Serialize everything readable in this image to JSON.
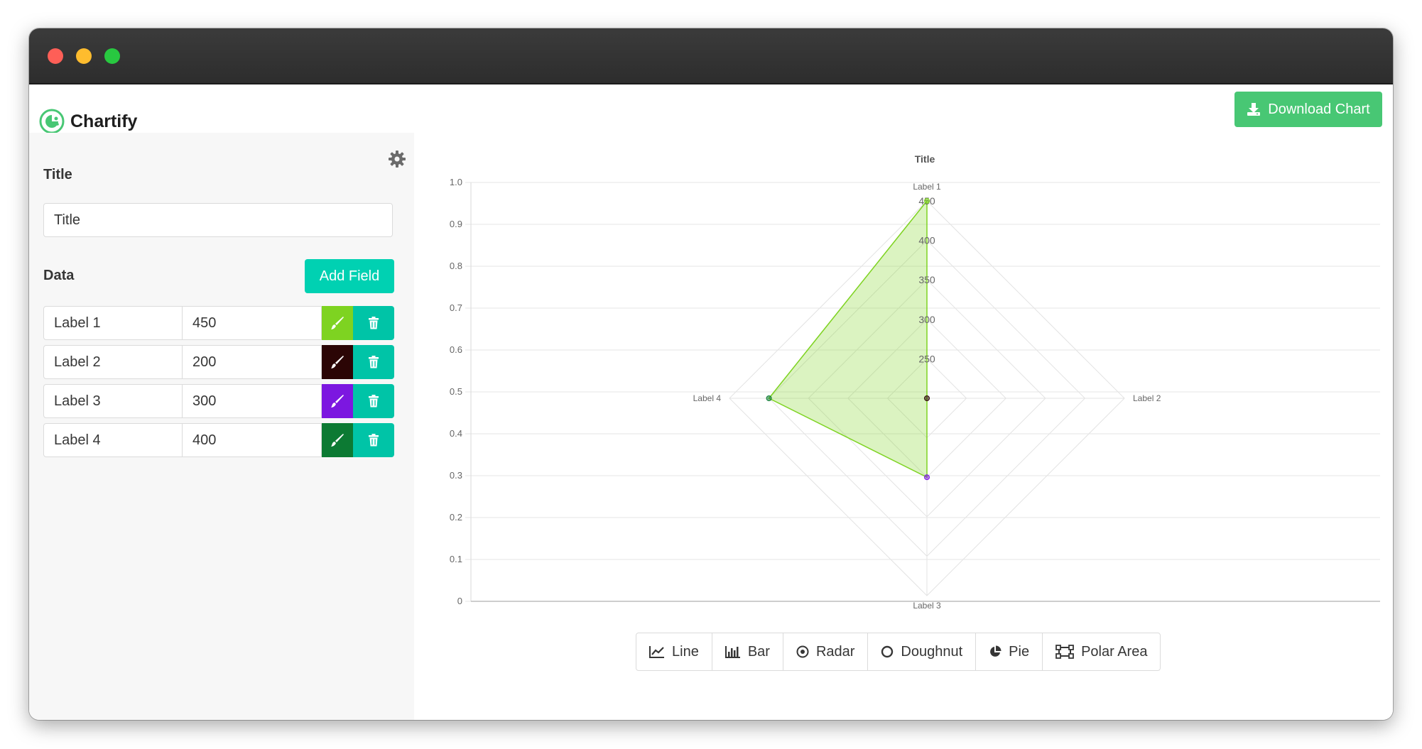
{
  "app": {
    "name": "Chartify"
  },
  "header": {
    "download_label": "Download Chart"
  },
  "sidebar": {
    "title_label": "Title",
    "title_value": "Title",
    "data_label": "Data",
    "add_field_label": "Add Field",
    "fields": [
      {
        "label": "Label 1",
        "value": "450",
        "color": "#7ed321"
      },
      {
        "label": "Label 2",
        "value": "200",
        "color": "#2b0505"
      },
      {
        "label": "Label 3",
        "value": "300",
        "color": "#7c17e0"
      },
      {
        "label": "Label 4",
        "value": "400",
        "color": "#0c7a33"
      }
    ]
  },
  "chart_types": [
    {
      "label": "Line",
      "icon": "line-chart-icon"
    },
    {
      "label": "Bar",
      "icon": "bar-chart-icon"
    },
    {
      "label": "Radar",
      "icon": "radar-icon"
    },
    {
      "label": "Doughnut",
      "icon": "doughnut-icon"
    },
    {
      "label": "Pie",
      "icon": "pie-icon"
    },
    {
      "label": "Polar Area",
      "icon": "polar-area-icon"
    }
  ],
  "chart_data": {
    "type": "radar",
    "title": "Title",
    "categories": [
      "Label 1",
      "Label 2",
      "Label 3",
      "Label 4"
    ],
    "series": [
      {
        "values": [
          450,
          200,
          300,
          400
        ],
        "color": "#7ed321"
      }
    ],
    "radial_ticks": [
      "250",
      "300",
      "350",
      "400",
      "450"
    ],
    "radial_range": [
      200,
      450
    ],
    "y_axis_ticks": [
      "0",
      "0.1",
      "0.2",
      "0.3",
      "0.4",
      "0.5",
      "0.6",
      "0.7",
      "0.8",
      "0.9",
      "1.0"
    ],
    "y_axis_range": [
      0,
      1
    ],
    "grid": true
  }
}
